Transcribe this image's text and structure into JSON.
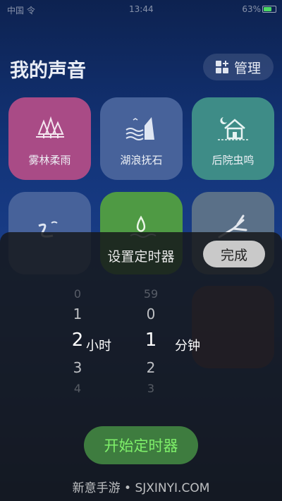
{
  "status_bar": {
    "carrier": "中国 令",
    "time": "13:44",
    "right_text": "63%"
  },
  "header": {
    "title": "我的声音",
    "manage_label": "管理"
  },
  "sounds": [
    {
      "label": "雾林柔雨",
      "icon": "forest-icon"
    },
    {
      "label": "湖浪抚石",
      "icon": "wave-cliff-icon"
    },
    {
      "label": "后院虫鸣",
      "icon": "house-moon-icon"
    },
    {
      "label": "",
      "icon": "river-icon"
    },
    {
      "label": "",
      "icon": "water-drop-icon"
    },
    {
      "label": "",
      "icon": "branch-icon"
    }
  ],
  "timer": {
    "title": "设置定时器",
    "done_label": "完成",
    "hours": {
      "values": [
        "0",
        "1",
        "2",
        "3",
        "4"
      ],
      "selected": "2",
      "unit": "小时"
    },
    "minutes": {
      "values": [
        "59",
        "0",
        "1",
        "2",
        "3"
      ],
      "selected": "1",
      "unit": "分钟"
    },
    "start_label": "开始定时器"
  },
  "watermark": "新意手游 • SJXINYI.COM",
  "colors": {
    "start_text": "#7ff06a",
    "start_bg": "#3e7c3f",
    "tile_pink": "#a94b86",
    "tile_blue": "#47629a",
    "tile_teal": "#3e8c87",
    "tile_green": "#4f9a44"
  }
}
